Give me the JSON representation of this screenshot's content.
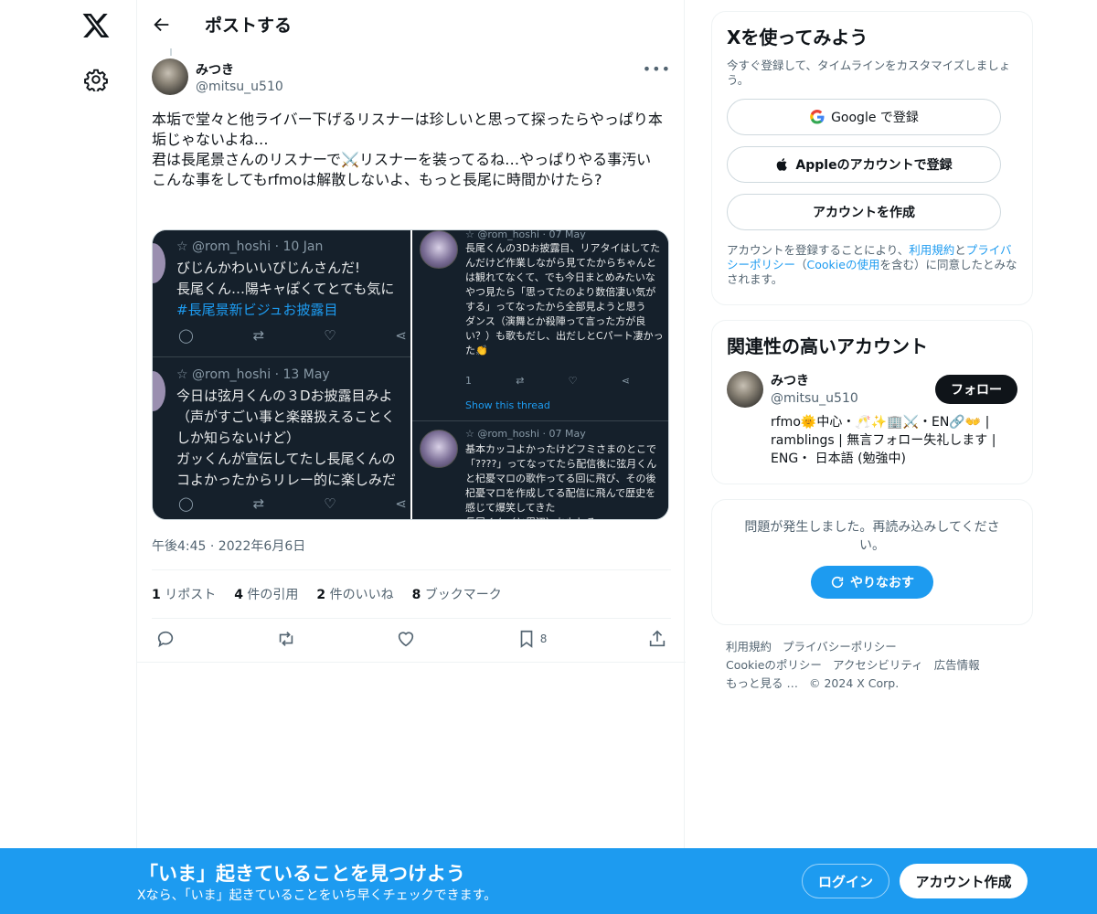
{
  "header": {
    "title": "ポストする"
  },
  "post": {
    "author_name": "みつき",
    "author_handle": "@mitsu_u510",
    "text": "本垢で堂々と他ライバー下げるリスナーは珍しいと思って探ったらやっぱり本垢じゃないよね…\n君は長尾景さんのリスナーで⚔️リスナーを装ってるね…やっぱりやる事汚い\nこんな事をしてもrfmoは解散しないよ、もっと長尾に時間かけたら?",
    "timestamp": "午後4:45 · 2022年6月6日",
    "stats": {
      "reposts_count": "1",
      "reposts_label": "リポスト",
      "quotes_count": "4",
      "quotes_label": "件の引用",
      "likes_count": "2",
      "likes_label": "件のいいね",
      "bookmarks_count": "8",
      "bookmarks_label": "ブックマーク"
    },
    "bookmark_action_count": "8"
  },
  "media": {
    "left": [
      {
        "header": "☆ @rom_hoshi · 10 Jan",
        "line1": "びじんかわいいびじんさんだ!",
        "line2": "長尾くん…陽キャぽくてとても気に",
        "hashtag": "#長尾景新ビジュお披露目"
      },
      {
        "header": "☆ @rom_hoshi · 13 May",
        "text": "今日は弦月くんの３Dお披露目みよ\n（声がすごい事と楽器扱えることく\nしか知らないけど）\nガッくんが宣伝してたし長尾くんの\nコよかったからリレー的に楽しみだ"
      }
    ],
    "right": [
      {
        "header": "☆ @rom_hoshi · 07 May",
        "text": "長尾くんの3Dお披露目、リアタイはしてたんだけど作業しながら見てたからちゃんとは観れてなくて、でも今日まとめみたいなやつ見たら「思ってたのより数倍凄い気がする」ってなったから全部見ようと思う\nダンス（演舞とか殺陣って言った方が良い？）も歌もだし、出だしとCパート凄かった👏",
        "reply_count": "1",
        "show_thread": "Show this thread"
      },
      {
        "header": "☆ @rom_hoshi · 07 May",
        "text": "基本カッコよかったけどフミさまのとこで「????」ってなってたら配信後に弦月くんと杞憂マロの歌作ってる回に飛び、その後杞憂マロを作成してる配信に飛んで歴史を感じて爆笑してきた\n長尾くん（と周辺）おもしろ"
      }
    ]
  },
  "signup_card": {
    "title": "Xを使ってみよう",
    "subtitle": "今すぐ登録して、タイムラインをカスタマイズしましょう。",
    "google_label": "Google で登録",
    "apple_label": "Appleのアカウントで登録",
    "create_label": "アカウントを作成",
    "terms_1": "アカウントを登録することにより、",
    "terms_link_1": "利用規約",
    "terms_2": "と",
    "terms_link_2": "プライバシーポリシー",
    "terms_3": "（",
    "terms_link_3": "Cookieの使用",
    "terms_4": "を含む）に同意したとみなされます。"
  },
  "related_card": {
    "title": "関連性の高いアカウント",
    "name": "みつき",
    "handle": "@mitsu_u510",
    "follow_label": "フォロー",
    "bio": "rfmo🌞中心・🥂✨🏢⚔️・EN🔗👐 | ramblings | 無言フォロー失礼します | ENG・ 日本語 (勉強中)"
  },
  "error_card": {
    "message": "問題が発生しました。再読み込みしてください。",
    "retry_label": "やりなおす"
  },
  "footer": {
    "links": [
      "利用規約",
      "プライバシーポリシー",
      "Cookieのポリシー",
      "アクセシビリティ",
      "広告情報",
      "もっと見る …",
      "© 2024 X Corp."
    ]
  },
  "banner": {
    "title": "「いま」起きていることを見つけよう",
    "subtitle": "Xなら、「いま」起きていることをいち早くチェックできます。",
    "login_label": "ログイン",
    "create_label": "アカウント作成"
  },
  "colors": {
    "accent": "#1d9bf0",
    "text": "#0f1419",
    "muted": "#536471",
    "media_bg": "#15202b"
  }
}
